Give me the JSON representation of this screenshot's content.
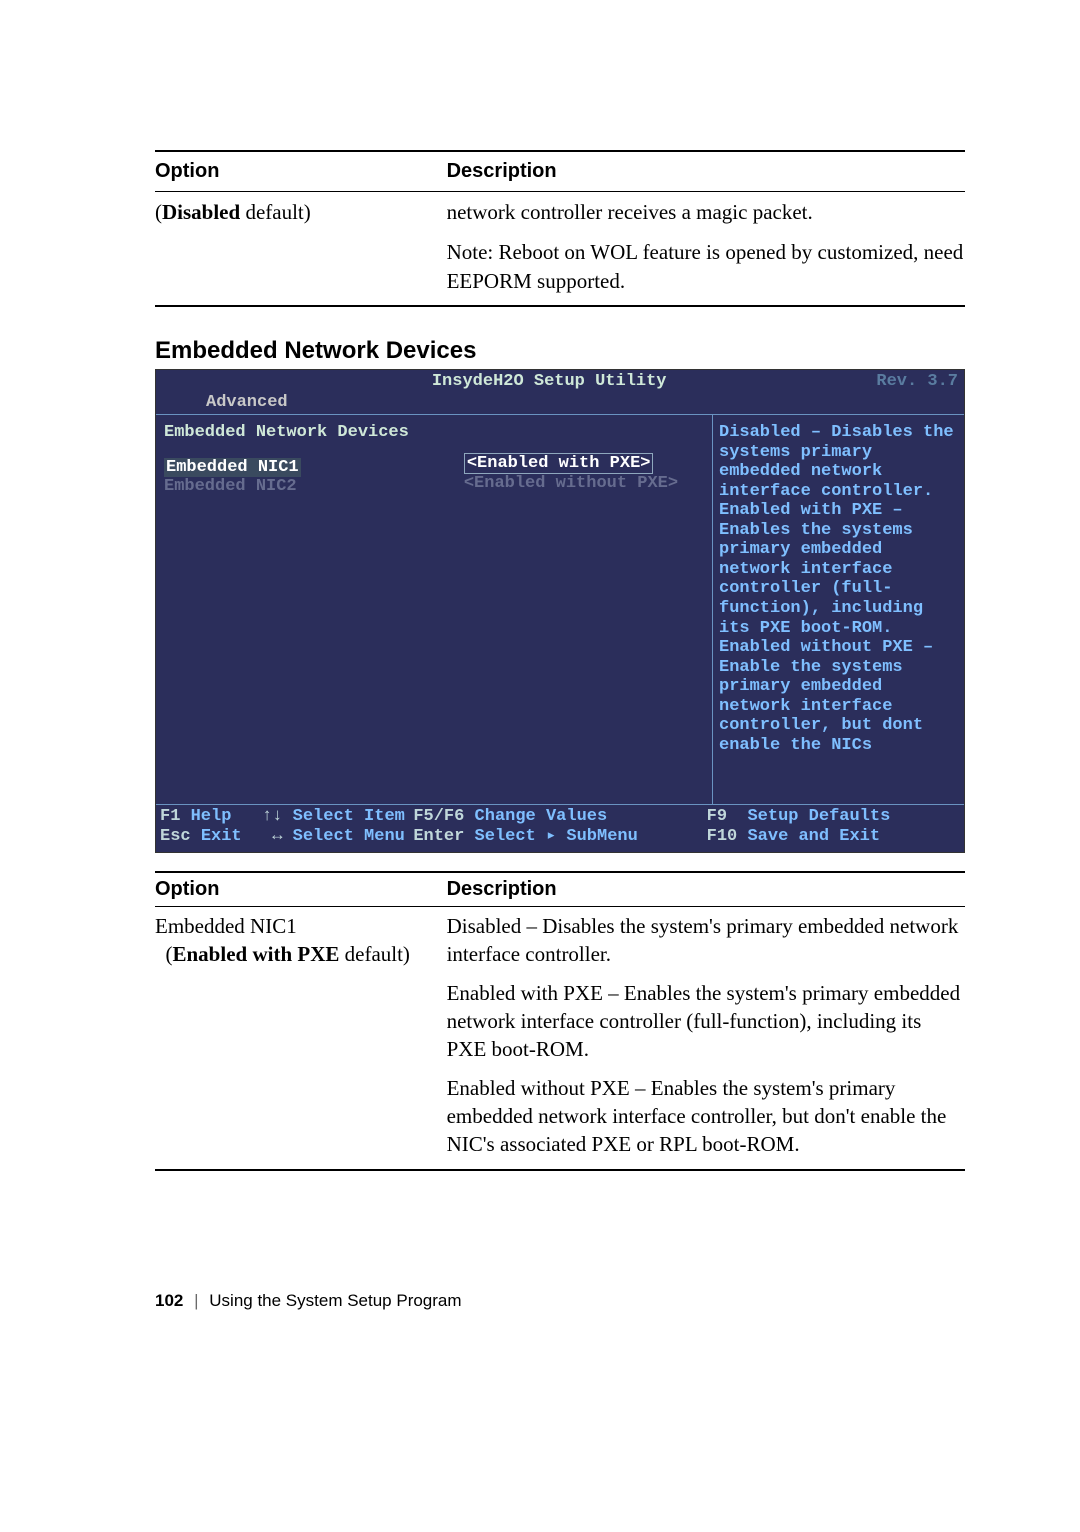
{
  "topTable": {
    "headers": {
      "option": "Option",
      "description": "Description"
    },
    "row": {
      "option_bold": "Disabled",
      "option_rest": " default)",
      "desc_line1": "network controller receives a magic packet.",
      "desc_line2": "Note: Reboot on WOL feature is opened by customized, need EEPORM supported."
    }
  },
  "sectionTitle": "Embedded Network Devices",
  "bios": {
    "title": "InsydeH2O Setup Utility",
    "rev": "Rev. 3.7",
    "tab": "Advanced",
    "left_heading": "Embedded Network Devices",
    "nic1_label": "Embedded NIC1",
    "nic2_label": "Embedded NIC2",
    "nic1_value": "<Enabled with PXE>",
    "nic2_value": "<Enabled without PXE>",
    "help_text": "Disabled – Disables the systems primary embedded network interface controller. Enabled with PXE – Enables the systems primary embedded network interface controller (full-function), including its PXE boot-ROM. Enabled without PXE – Enable the systems primary embedded network interface controller, but dont enable the NICs",
    "footer": {
      "f1k": "F1",
      "f1l": "Help",
      "upk": "↑↓",
      "upl": "Select Item",
      "esck": "Esc",
      "escl": "Exit",
      "lrk": "↔",
      "lrl": "Select Menu",
      "f56k": "F5/F6",
      "f56l": "Change Values",
      "entk": "Enter",
      "entl": "Select ▸ SubMenu",
      "f9k": "F9",
      "f9l": "Setup Defaults",
      "f10k": "F10",
      "f10l": "Save and Exit"
    }
  },
  "bottomTable": {
    "headers": {
      "option": "Option",
      "description": "Description"
    },
    "row": {
      "opt_line1": "Embedded NIC1",
      "opt_bold": "Enabled with PXE",
      "opt_rest": " default)",
      "desc1": "Disabled – Disables the system's primary embedded network interface controller.",
      "desc2": "Enabled with PXE – Enables the system's primary embedded network interface controller (full-function), including its PXE boot-ROM.",
      "desc3": "Enabled without PXE – Enables the system's primary embedded network interface controller, but don't enable the NIC's associated PXE or RPL boot-ROM."
    }
  },
  "pageFooter": {
    "page": "102",
    "chapter": "Using the System Setup Program"
  }
}
